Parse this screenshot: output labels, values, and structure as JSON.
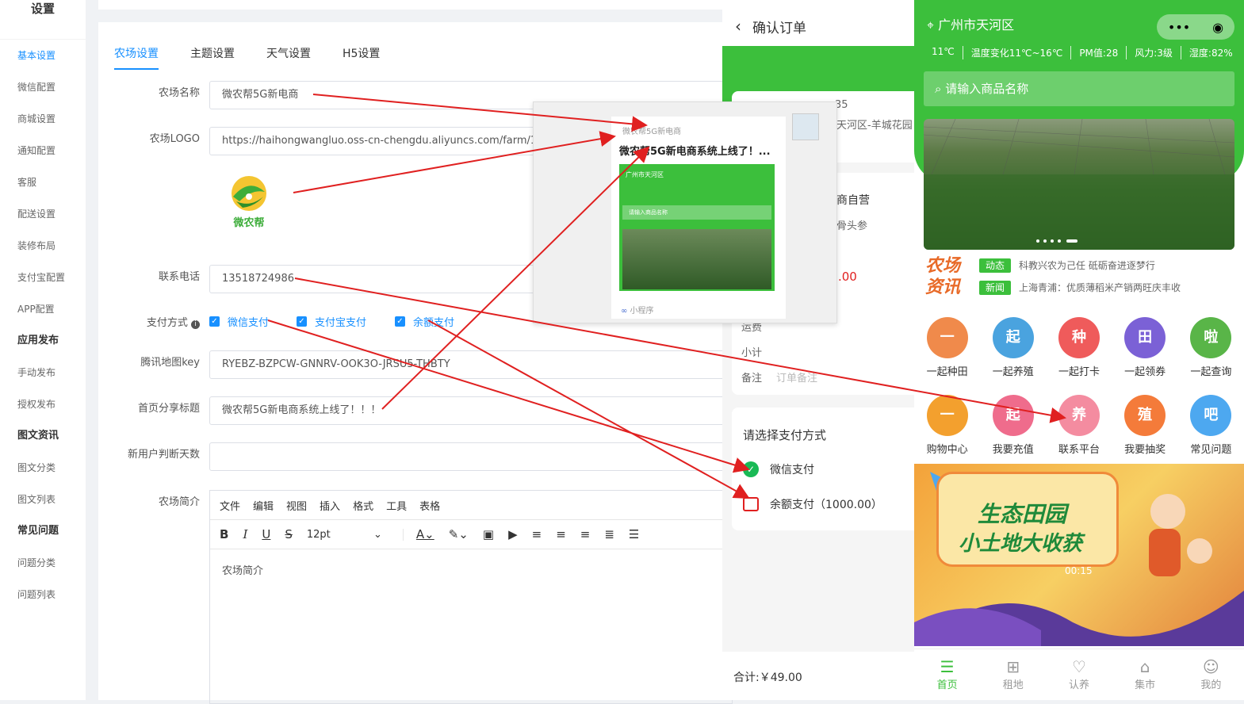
{
  "sidebar": {
    "title": "设置",
    "items": [
      {
        "label": "基本设置",
        "active": true
      },
      {
        "label": "微信配置"
      },
      {
        "label": "商城设置"
      },
      {
        "label": "通知配置"
      },
      {
        "label": "客服"
      },
      {
        "label": "配送设置"
      },
      {
        "label": "装修布局"
      },
      {
        "label": "支付宝配置"
      },
      {
        "label": "APP配置"
      },
      {
        "label": "应用发布",
        "group": true
      },
      {
        "label": "手动发布"
      },
      {
        "label": "授权发布"
      },
      {
        "label": "图文资讯",
        "group": true
      },
      {
        "label": "图文分类"
      },
      {
        "label": "图文列表"
      },
      {
        "label": "常见问题",
        "group": true
      },
      {
        "label": "问题分类"
      },
      {
        "label": "问题列表"
      }
    ]
  },
  "tabs": [
    "农场设置",
    "主题设置",
    "天气设置",
    "H5设置"
  ],
  "form": {
    "farm_name_label": "农场名称",
    "farm_name": "微农帮5G新电商",
    "logo_label": "农场LOGO",
    "logo_url": "https://haihongwangluo.oss-cn-chengdu.aliyuncs.com/farm/1/jpg",
    "logo_text": "微农帮",
    "phone_label": "联系电话",
    "phone": "13518724986",
    "pay_label": "支付方式",
    "pay_options": [
      "微信支付",
      "支付宝支付",
      "余额支付"
    ],
    "map_key_label": "腾讯地图key",
    "map_key": "RYEBZ-BZPCW-GNNRV-OOK3O-JRSU5-THBTY",
    "share_title_label": "首页分享标题",
    "share_title": "微农帮5G新电商系统上线了！！！",
    "new_user_label": "新用户判断天数",
    "new_user_days": "",
    "intro_label": "农场简介",
    "editor_menu": [
      "文件",
      "编辑",
      "视图",
      "插入",
      "格式",
      "工具",
      "表格"
    ],
    "font_size": "12pt",
    "editor_placeholder": "农场简介"
  },
  "share_card": {
    "app_name": "微农帮5G新电商",
    "title": "微农帮5G新电商系统上线了！...",
    "footer": "小程序",
    "mini_loc": "广州市天河区",
    "mini_search": "请输入商品名称"
  },
  "order": {
    "title": "确认订单",
    "address_fragment1": "35",
    "address_fragment2": "天河区-羊城花园",
    "shop": "商自营",
    "product": "骨头参",
    "price": ".00",
    "freight_label": "运费",
    "subtotal_label": "小计",
    "note_label": "备注",
    "note_placeholder": "订单备注",
    "pay_title": "请选择支付方式",
    "pay_wechat": "微信支付",
    "pay_balance": "余额支付（1000.00）",
    "total": "合计:￥49.00"
  },
  "home": {
    "location": "广州市天河区",
    "weather": [
      "11℃",
      "温度变化11℃~16℃",
      "PM值:28",
      "风力:3级",
      "湿度:82%"
    ],
    "search_placeholder": "请输入商品名称",
    "news_logo": [
      "农场",
      "资讯"
    ],
    "news": [
      {
        "tag": "动态",
        "text": "科教兴农为己任 砥砺奋进逐梦行",
        "color": "#3cbf3c"
      },
      {
        "tag": "新闻",
        "text": "上海青浦：优质薄稻米产销两旺庆丰收",
        "color": "#3cbf3c"
      }
    ],
    "grid_row1": [
      {
        "label": "一起种田",
        "glyph": "一",
        "color": "#f08a4b"
      },
      {
        "label": "一起养殖",
        "glyph": "起",
        "color": "#4aa3df"
      },
      {
        "label": "一起打卡",
        "glyph": "种",
        "color": "#ef5b5b"
      },
      {
        "label": "一起领券",
        "glyph": "田",
        "color": "#7b61d6"
      },
      {
        "label": "一起查询",
        "glyph": "啦",
        "color": "#59b548"
      }
    ],
    "grid_row2": [
      {
        "label": "购物中心",
        "glyph": "一",
        "color": "#f3a02e"
      },
      {
        "label": "我要充值",
        "glyph": "起",
        "color": "#ef6c8c"
      },
      {
        "label": "联系平台",
        "glyph": "养",
        "color": "#f48ca0"
      },
      {
        "label": "我要抽奖",
        "glyph": "殖",
        "color": "#f47b3a"
      },
      {
        "label": "常见问题",
        "glyph": "吧",
        "color": "#4da8f0"
      }
    ],
    "poster_line1": "生态田园",
    "poster_line2": "小土地大收获",
    "poster_time": "00:15",
    "tabbar": [
      "首页",
      "租地",
      "认养",
      "集市",
      "我的"
    ]
  },
  "colors": {
    "primary": "#1890ff",
    "green": "#3cbf3c",
    "arrow": "#e02020"
  }
}
